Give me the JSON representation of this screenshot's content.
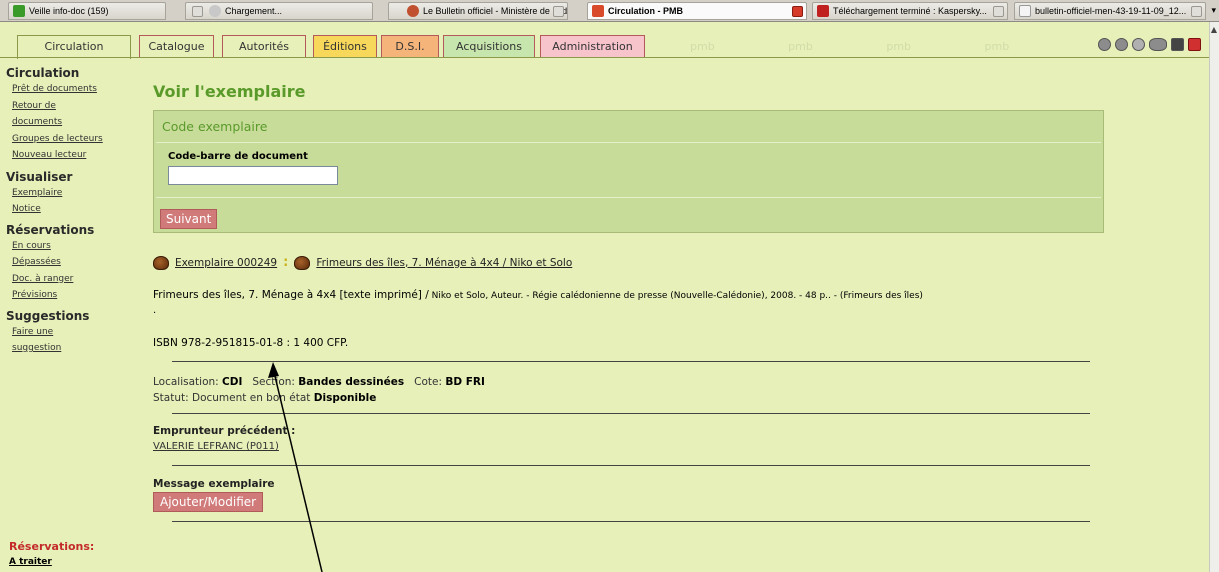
{
  "browser_tabs": [
    {
      "label": "Veille info-doc (159)",
      "icon": "green-plus-icon"
    },
    {
      "label": "Chargement...",
      "icon": "loading-icon"
    },
    {
      "label": "Le Bulletin officiel - Ministère de l'Edu...",
      "icon": "ministry-icon"
    },
    {
      "label": "Circulation - PMB",
      "icon": "pmb-icon"
    },
    {
      "label": "Téléchargement terminé : Kaspersky...",
      "icon": "download-icon"
    },
    {
      "label": "bulletin-officiel-men-43-19-11-09_12...",
      "icon": "document-icon"
    }
  ],
  "app_menu": [
    {
      "label": "Circulation"
    },
    {
      "label": "Catalogue"
    },
    {
      "label": "Autorités"
    },
    {
      "label": "Éditions"
    },
    {
      "label": "D.S.I."
    },
    {
      "label": "Acquisitions"
    },
    {
      "label": "Administration"
    }
  ],
  "ghost_tabs": "pmb pmb pmb pmb",
  "app_icons": [
    "refresh-icon",
    "help-icon",
    "settings-icon",
    "opac-icon",
    "save-icon",
    "close-icon"
  ],
  "sidebar": {
    "sections": [
      {
        "title": "Circulation",
        "links": [
          "Prêt de documents",
          "Retour de",
          "documents",
          "Groupes de lecteurs",
          "Nouveau lecteur"
        ]
      },
      {
        "title": "Visualiser",
        "links": [
          "Exemplaire",
          "Notice"
        ]
      },
      {
        "title": "Réservations",
        "links": [
          "En cours",
          "Dépassées",
          "Doc. à ranger",
          "Prévisions"
        ]
      },
      {
        "title": "Suggestions",
        "links": [
          "Faire une",
          "suggestion"
        ]
      }
    ],
    "reservations_label": "Réservations:",
    "a_traiter": "A traiter"
  },
  "main": {
    "title": "Voir l'exemplaire",
    "code_box_title": "Code exemplaire",
    "barcode_label": "Code-barre de document",
    "barcode_value": "",
    "suivant": "Suivant",
    "exemplaire_link": "Exemplaire 000249",
    "separator": ":",
    "notice_link": "Frimeurs des îles, 7. Ménage à 4x4 / Niko et Solo",
    "notice_title": "Frimeurs des îles, 7. Ménage à 4x4 [texte imprimé] /",
    "notice_rest": "Niko et Solo, Auteur. - Régie calédonienne de presse (Nouvelle-Calédonie), 2008. - 48 p.. - (Frimeurs des îles)",
    "notice_dot": ".",
    "isbn": "ISBN 978-2-951815-01-8 : 1 400 CFP.",
    "localisation_label": "Localisation:",
    "localisation_value": "CDI",
    "section_label": "Section:",
    "section_value": "Bandes dessinées",
    "cote_label": "Cote:",
    "cote_value": "BD FRI",
    "statut_label": "Statut:",
    "statut_text": "Document en bon état",
    "statut_value": "Disponible",
    "emprunteur_label": "Emprunteur précédent :",
    "emprunteur_value": "VALERIE LEFRANC (P011)",
    "message_label": "Message exemplaire",
    "ajouter": "Ajouter/Modifier"
  },
  "colors": {
    "accent_green": "#5a9a2a",
    "button_red": "#d07a7a",
    "page_bg": "#e6f0b8"
  }
}
